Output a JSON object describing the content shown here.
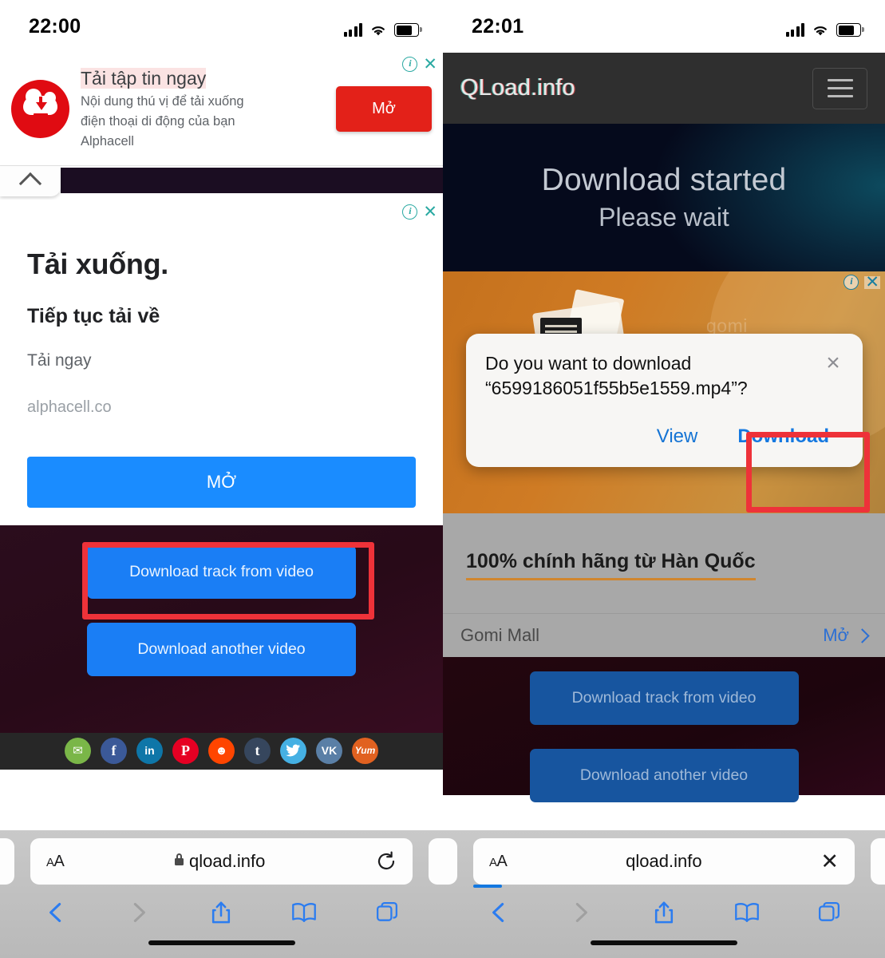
{
  "left": {
    "status": {
      "time": "22:00"
    },
    "ad_banner": {
      "title": "Tải tập tin ngay",
      "desc_line1": "Nội dung thú vị để tải xuống",
      "desc_line2": "điện thoại di động của bạn",
      "desc_line3": "Alphacell",
      "button": "Mở",
      "info_icon": "info-icon",
      "close_icon": "close-icon",
      "logo_icon": "cloud-download-icon"
    },
    "collapse_icon": "chevron-up-icon",
    "ad_card": {
      "heading": "Tải xuống.",
      "subheading": "Tiếp tục tải về",
      "caption": "Tải ngay",
      "url": "alphacell.co",
      "cta": "MỞ",
      "info_icon": "info-icon",
      "close_icon": "close-icon"
    },
    "site": {
      "btn_track": "Download track from video",
      "btn_another": "Download another video"
    },
    "social": [
      {
        "name": "email-share",
        "glyph": "✉",
        "class": "mail"
      },
      {
        "name": "facebook-share",
        "glyph": "f",
        "class": "fb"
      },
      {
        "name": "linkedin-share",
        "glyph": "in",
        "class": "li"
      },
      {
        "name": "pinterest-share",
        "glyph": "P",
        "class": "pi"
      },
      {
        "name": "reddit-share",
        "glyph": "☻",
        "class": "rd"
      },
      {
        "name": "tumblr-share",
        "glyph": "t",
        "class": "tu"
      },
      {
        "name": "twitter-share",
        "glyph": "🐦",
        "class": "tw"
      },
      {
        "name": "vk-share",
        "glyph": "VK",
        "class": "vk"
      },
      {
        "name": "yummly-share",
        "glyph": "Yum",
        "class": "ym"
      }
    ],
    "safari": {
      "aa_small": "A",
      "aa_big": "A",
      "url": "qload.info",
      "reload_icon": "reload-icon",
      "back_icon": "back-chevron-icon",
      "forward_icon": "forward-chevron-icon",
      "share_icon": "share-icon",
      "bookmarks_icon": "book-icon",
      "tabs_icon": "tabs-icon"
    }
  },
  "right": {
    "status": {
      "time": "22:01"
    },
    "header": {
      "brand": "QLoad.info",
      "menu_icon": "hamburger-menu-icon"
    },
    "hero": {
      "line1": "Download started",
      "line2": "Please wait"
    },
    "orange_ad": {
      "watermark": "gomi",
      "info_icon": "info-icon",
      "close_icon": "close-icon"
    },
    "modal": {
      "question_line1": "Do you want to download",
      "question_line2": "“6599186051f55b5e1559.mp4”?",
      "filename": "6599186051f55b5e1559.mp4",
      "close_icon": "close-icon",
      "view": "View",
      "download": "Download"
    },
    "gray_ad": {
      "headline": "100% chính hãng từ Hàn Quốc",
      "brand": "Gomi Mall",
      "open": "Mở",
      "chevron_icon": "chevron-right-icon"
    },
    "site": {
      "btn_track": "Download track from video",
      "btn_another": "Download another video"
    },
    "safari": {
      "aa_small": "A",
      "aa_big": "A",
      "url": "qload.info",
      "stop_icon": "close-icon",
      "back_icon": "back-chevron-icon",
      "forward_icon": "forward-chevron-icon",
      "share_icon": "share-icon",
      "bookmarks_icon": "book-icon",
      "tabs_icon": "tabs-icon"
    }
  },
  "annotations": {
    "highlight_color": "#ee3239",
    "left_target": "Download track from video",
    "right_target": "Download"
  }
}
